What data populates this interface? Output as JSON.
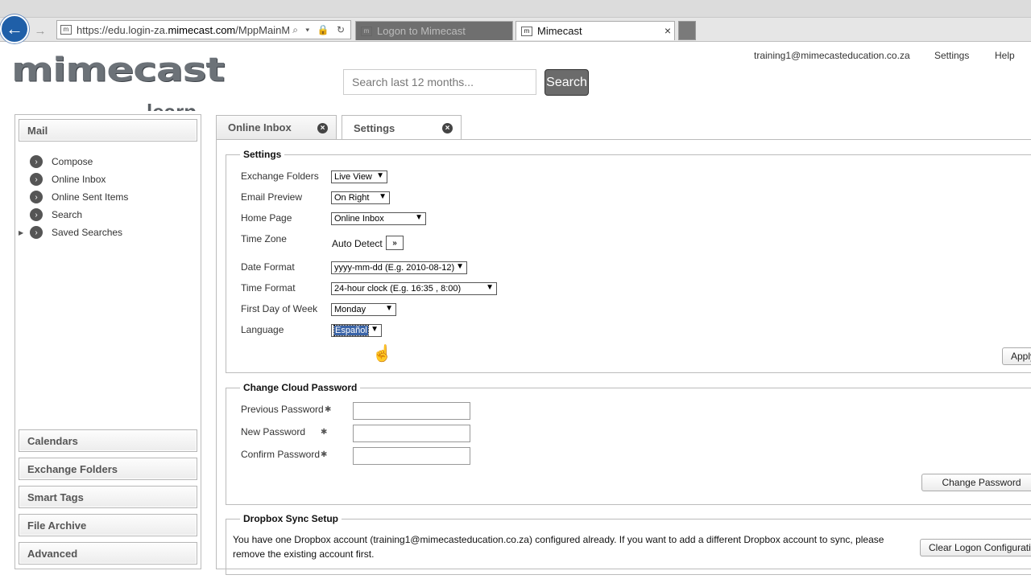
{
  "browser": {
    "address_url_prefix": "https://edu.login-za.",
    "address_url_domain": "mimecast.com",
    "address_url_suffix": "/MppMainMod",
    "address_controls": "⌕ ▾ 🔒 ↻",
    "tabs": [
      {
        "label": "Logon to Mimecast",
        "active": false
      },
      {
        "label": "Mimecast",
        "active": true
      }
    ],
    "close_glyph": "×"
  },
  "header": {
    "logo_text": "mimecast",
    "logo_sub": "learn",
    "search_placeholder": "Search last 12 months...",
    "search_button": "Search",
    "user_email": "training1@mimecasteducation.co.za",
    "settings_link": "Settings",
    "help_link": "Help"
  },
  "sidebar": {
    "mail_heading": "Mail",
    "mail_items": [
      "Compose",
      "Online Inbox",
      "Online Sent Items",
      "Search",
      "Saved Searches"
    ],
    "expander_glyph": "▶",
    "sections": [
      "Calendars",
      "Exchange Folders",
      "Smart Tags",
      "File Archive",
      "Advanced"
    ]
  },
  "content_tabs": [
    {
      "label": "Online Inbox",
      "active": false
    },
    {
      "label": "Settings",
      "active": true
    }
  ],
  "settings": {
    "legend": "Settings",
    "exchange_folders_label": "Exchange Folders",
    "exchange_folders_value": "Live View",
    "email_preview_label": "Email Preview",
    "email_preview_value": "On Right",
    "home_page_label": "Home Page",
    "home_page_value": "Online Inbox",
    "time_zone_label": "Time Zone",
    "time_zone_value": "Auto Detect",
    "time_zone_button": "»",
    "date_format_label": "Date Format",
    "date_format_value": "yyyy-mm-dd (E.g. 2010-08-12)",
    "time_format_label": "Time Format",
    "time_format_value": "24-hour clock (E.g. 16:35 , 8:00)",
    "first_day_label": "First Day of Week",
    "first_day_value": "Monday",
    "language_label": "Language",
    "language_value": "Español",
    "apply_button": "Apply"
  },
  "password": {
    "legend": "Change Cloud Password",
    "previous_label": "Previous Password",
    "new_label": "New Password",
    "confirm_label": "Confirm Password",
    "required_mark": "✱",
    "change_button": "Change Password"
  },
  "dropbox": {
    "legend": "Dropbox Sync Setup",
    "message": "You have one Dropbox account (training1@mimecasteducation.co.za) configured already. If you want to add a different Dropbox account to sync, please remove the existing account first.",
    "clear_button": "Clear Logon Configuration"
  }
}
